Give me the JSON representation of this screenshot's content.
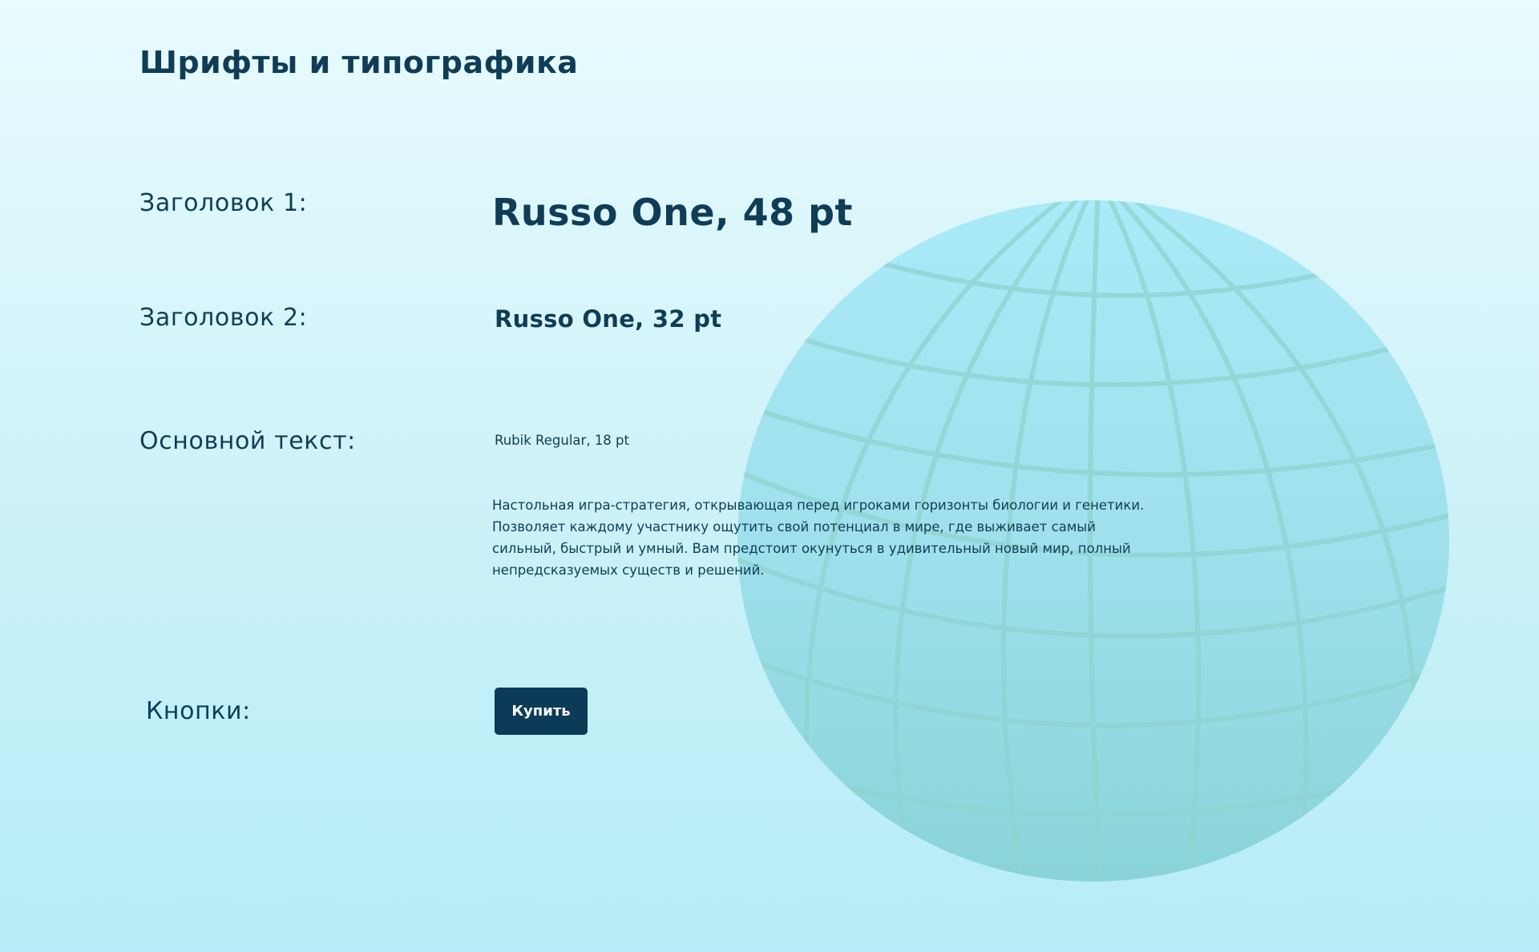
{
  "page": {
    "title": "Шрифты и типографика"
  },
  "rows": {
    "heading1": {
      "label": "Заголовок 1:",
      "sample": "Russo One, 48 pt"
    },
    "heading2": {
      "label": "Заголовок 2:",
      "sample": "Russo One, 32 pt"
    },
    "body": {
      "label": "Основной текст:",
      "sample_label": "Rubik Regular, 18 pt",
      "paragraph": "Настольная игра-стратегия, открывающая перед игроками горизонты биологии и генетики. Позволяет каждому участнику ощутить свой потенциал в мире, где выживает самый сильный, быстрый и умный. Вам предстоит окунуться в удивительный новый мир, полный непредсказуемых существ и решений."
    },
    "buttons": {
      "label": "Кнопки:",
      "buy_label": "Купить"
    }
  },
  "colors": {
    "background_top": "#e8fbfe",
    "background_bottom": "#b6ecf7",
    "text_primary": "#0f3d57",
    "button_bg": "#0c3b58",
    "button_text": "#ffffff",
    "globe_fill": "#9ee3ee",
    "globe_grid": "#8fd3cf"
  },
  "icons": {
    "globe": "globe-icon"
  }
}
